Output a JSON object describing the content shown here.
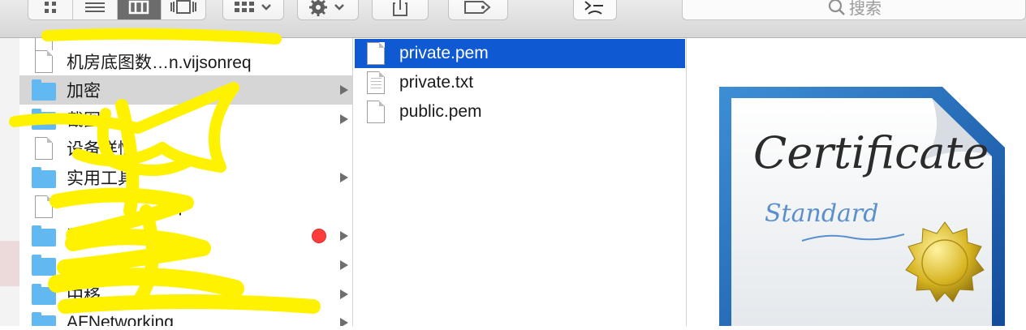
{
  "toolbar": {
    "view_modes": [
      {
        "name": "icon-view",
        "active": false
      },
      {
        "name": "list-view",
        "active": false
      },
      {
        "name": "column-view",
        "active": true
      },
      {
        "name": "coverflow-view",
        "active": false
      }
    ],
    "arrange_icon": "grid-icon",
    "action_icon": "gear-icon",
    "share_icon": "share-icon",
    "tag_icon": "tag-icon",
    "search_placeholder": "搜索"
  },
  "column1": {
    "items": [
      {
        "label": "",
        "kind": "file",
        "has_arrow": false
      },
      {
        "label": "机房底图数…n.vijsonreq",
        "kind": "file",
        "has_arrow": false
      },
      {
        "label": "加密",
        "kind": "folder",
        "has_arrow": true,
        "selected": true
      },
      {
        "label": "截图",
        "kind": "folder",
        "has_arrow": true
      },
      {
        "label": "设备详情",
        "kind": "file",
        "has_arrow": false
      },
      {
        "label": "实用工具",
        "kind": "folder",
        "has_arrow": true
      },
      {
        "label": "req",
        "kind": "file",
        "has_arrow": false
      },
      {
        "label": "数据",
        "kind": "folder",
        "has_arrow": true,
        "tag_color": "#fc3d39"
      },
      {
        "label": "",
        "kind": "folder",
        "has_arrow": true
      },
      {
        "label": "中移",
        "kind": "folder",
        "has_arrow": true
      },
      {
        "label": "AFNetworking",
        "kind": "folder",
        "has_arrow": true
      }
    ]
  },
  "column2": {
    "items": [
      {
        "label": "private.pem",
        "kind": "pem",
        "selected": true
      },
      {
        "label": "private.txt",
        "kind": "txt",
        "selected": false
      },
      {
        "label": "public.pem",
        "kind": "pem",
        "selected": false
      }
    ]
  },
  "preview": {
    "title_script": "Certificate",
    "subtitle_script": "Standard"
  },
  "colors": {
    "selection_blue": "#0f5ad3",
    "folder_blue": "#62b8f1",
    "tag_red": "#fc3d39",
    "highlight_yellow": "#fff200"
  }
}
